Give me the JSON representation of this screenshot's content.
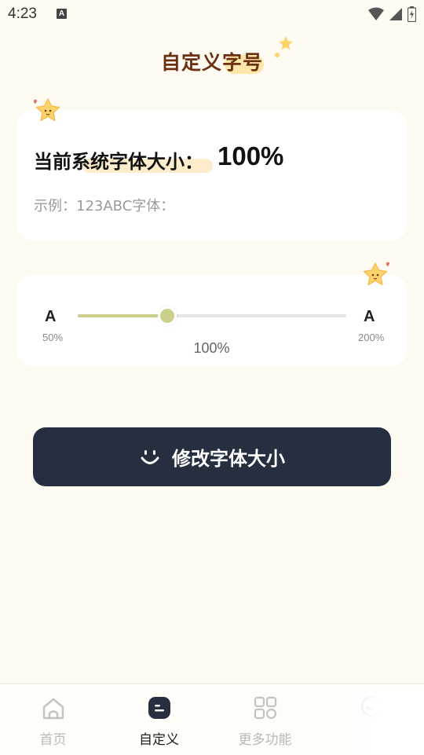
{
  "status_bar": {
    "time": "4:23",
    "notification_badge": "A"
  },
  "header": {
    "title": "自定义字号"
  },
  "current_card": {
    "label": "当前系统字体大小：",
    "value": "100%",
    "sample": "示例：123ABC字体："
  },
  "slider": {
    "small_icon_text": "A",
    "large_icon_text": "A",
    "min_label": "50%",
    "max_label": "200%",
    "value_label": "100%",
    "min": 50,
    "max": 200,
    "value": 100
  },
  "action_button": {
    "label": "修改字体大小",
    "icon": "smile-icon"
  },
  "bottom_nav": {
    "items": [
      {
        "label": "首页",
        "icon": "home-icon",
        "active": false
      },
      {
        "label": "自定义",
        "icon": "customize-icon",
        "active": true
      },
      {
        "label": "更多功能",
        "icon": "grid-icon",
        "active": false
      },
      {
        "label": "",
        "icon": "smiley-icon",
        "active": false
      }
    ]
  },
  "colors": {
    "background": "#fdfaf1",
    "title": "#6b2f12",
    "accent": "#cbcf8a",
    "button": "#252f40",
    "star": "#fcd36a"
  }
}
